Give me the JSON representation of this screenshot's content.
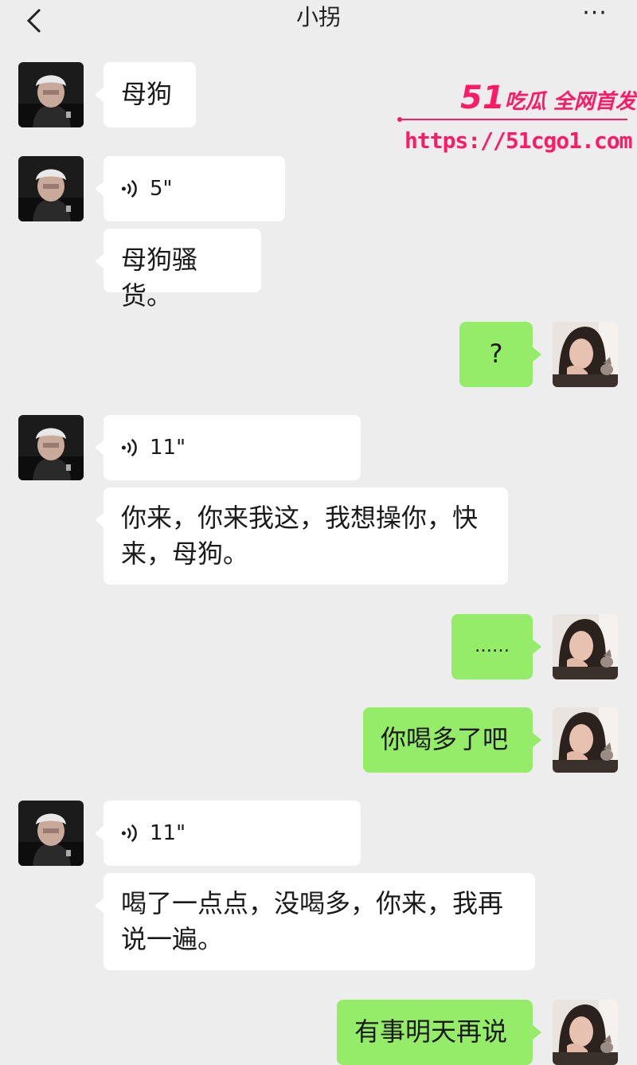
{
  "header": {
    "title": "小拐",
    "back_icon": "chevron-left-icon",
    "more_label": "···"
  },
  "watermark": {
    "brand_number": "51",
    "brand_text": "吃瓜 全网首发",
    "url": "https://51cgo1.com",
    "color": "#ff1a66"
  },
  "colors": {
    "incoming_bubble": "#ffffff",
    "outgoing_bubble": "#95ec69",
    "background": "#ededed"
  },
  "messages": [
    {
      "from": "contact",
      "type": "text",
      "text": "母狗"
    },
    {
      "from": "contact",
      "type": "voice",
      "duration": "5\""
    },
    {
      "from": "contact",
      "type": "text",
      "text": "母狗骚货。"
    },
    {
      "from": "me",
      "type": "text",
      "text": "?"
    },
    {
      "from": "contact",
      "type": "voice",
      "duration": "11\""
    },
    {
      "from": "contact",
      "type": "text",
      "line1": "你来，你来我这，我想操你，快",
      "line2": "来，母狗。"
    },
    {
      "from": "me",
      "type": "text",
      "text": "……"
    },
    {
      "from": "me",
      "type": "text",
      "text": "你喝多了吧"
    },
    {
      "from": "contact",
      "type": "voice",
      "duration": "11\""
    },
    {
      "from": "contact",
      "type": "text",
      "line1": "喝了一点点，没喝多，你来，我再",
      "line2": "说一遍。"
    },
    {
      "from": "me",
      "type": "text",
      "text": "有事明天再说"
    }
  ]
}
